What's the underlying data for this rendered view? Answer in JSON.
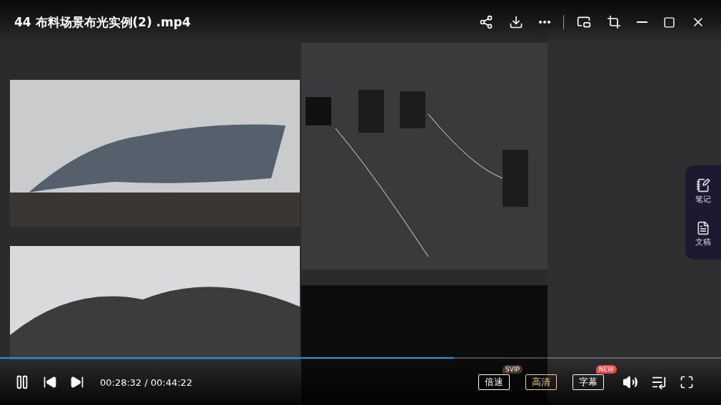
{
  "title": "44 布料场景布光实例(2) .mp4",
  "side_panel": [
    {
      "label": "笔记",
      "kind": "notes"
    },
    {
      "label": "文稿",
      "kind": "transcript"
    }
  ],
  "progress": {
    "level": 0.63
  },
  "time": "00:28:32 / 00:44:22",
  "options": [
    {
      "label": "倍速",
      "highlighted": false,
      "badge": {
        "text": "SVIP",
        "color": "#4a3528"
      }
    },
    {
      "label": "高清",
      "highlighted": true
    },
    {
      "label": "字幕",
      "highlighted": false,
      "badge": {
        "text": "NEW",
        "color": "#f04848"
      }
    }
  ]
}
